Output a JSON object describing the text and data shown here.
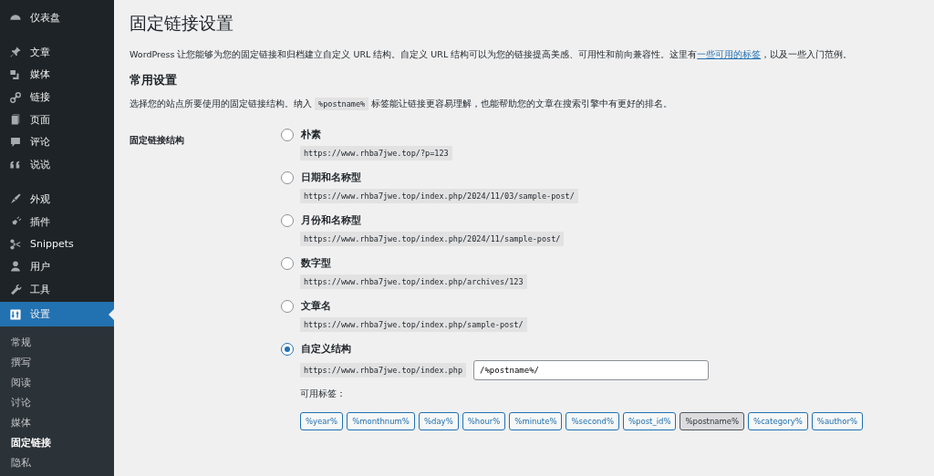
{
  "sidebar": {
    "menu": [
      {
        "label": "仪表盘",
        "gap_before": false,
        "selected": false
      },
      {
        "label": "文章",
        "gap_before": true,
        "selected": false
      },
      {
        "label": "媒体",
        "gap_before": false,
        "selected": false
      },
      {
        "label": "链接",
        "gap_before": false,
        "selected": false
      },
      {
        "label": "页面",
        "gap_before": false,
        "selected": false
      },
      {
        "label": "评论",
        "gap_before": false,
        "selected": false
      },
      {
        "label": "说说",
        "gap_before": false,
        "selected": false
      },
      {
        "label": "外观",
        "gap_before": true,
        "selected": false
      },
      {
        "label": "插件",
        "gap_before": false,
        "selected": false
      },
      {
        "label": "Snippets",
        "gap_before": false,
        "selected": false
      },
      {
        "label": "用户",
        "gap_before": false,
        "selected": false
      },
      {
        "label": "工具",
        "gap_before": false,
        "selected": false
      },
      {
        "label": "设置",
        "gap_before": false,
        "selected": true
      }
    ],
    "submenu": [
      {
        "label": "常规",
        "selected": false
      },
      {
        "label": "撰写",
        "selected": false
      },
      {
        "label": "阅读",
        "selected": false
      },
      {
        "label": "讨论",
        "selected": false
      },
      {
        "label": "媒体",
        "selected": false
      },
      {
        "label": "固定链接",
        "selected": true
      },
      {
        "label": "隐私",
        "selected": false
      }
    ]
  },
  "page": {
    "title": "固定链接设置",
    "intro": {
      "before": "WordPress 让您能够为您的固定链接和归档建立自定义 URL 结构。自定义 URL 结构可以为您的链接提高美感、可用性和前向兼容性。这里有",
      "link": "一些可用的标签",
      "after": "，以及一些入门范例。"
    },
    "section_title": "常用设置",
    "description": {
      "before": "选择您的站点所要使用的固定链接结构。纳入 ",
      "code": "%postname%",
      "after": " 标签能让链接更容易理解，也能帮助您的文章在搜索引擎中有更好的排名。"
    },
    "field_label": "固定链接结构",
    "options": [
      {
        "label": "朴素",
        "example": "https://www.rhba7jwe.top/?p=123",
        "selected": false
      },
      {
        "label": "日期和名称型",
        "example": "https://www.rhba7jwe.top/index.php/2024/11/03/sample-post/",
        "selected": false
      },
      {
        "label": "月份和名称型",
        "example": "https://www.rhba7jwe.top/index.php/2024/11/sample-post/",
        "selected": false
      },
      {
        "label": "数字型",
        "example": "https://www.rhba7jwe.top/index.php/archives/123",
        "selected": false
      },
      {
        "label": "文章名",
        "example": "https://www.rhba7jwe.top/index.php/sample-post/",
        "selected": false
      }
    ],
    "custom": {
      "label": "自定义结构",
      "selected": true,
      "prefix": "https://www.rhba7jwe.top/index.php",
      "value": "/%postname%/",
      "tags_label": "可用标签：",
      "tags": [
        {
          "label": "%year%",
          "selected": false
        },
        {
          "label": "%monthnum%",
          "selected": false
        },
        {
          "label": "%day%",
          "selected": false
        },
        {
          "label": "%hour%",
          "selected": false
        },
        {
          "label": "%minute%",
          "selected": false
        },
        {
          "label": "%second%",
          "selected": false
        },
        {
          "label": "%post_id%",
          "selected": false
        },
        {
          "label": "%postname%",
          "selected": true
        },
        {
          "label": "%category%",
          "selected": false
        },
        {
          "label": "%author%",
          "selected": false
        }
      ]
    }
  }
}
